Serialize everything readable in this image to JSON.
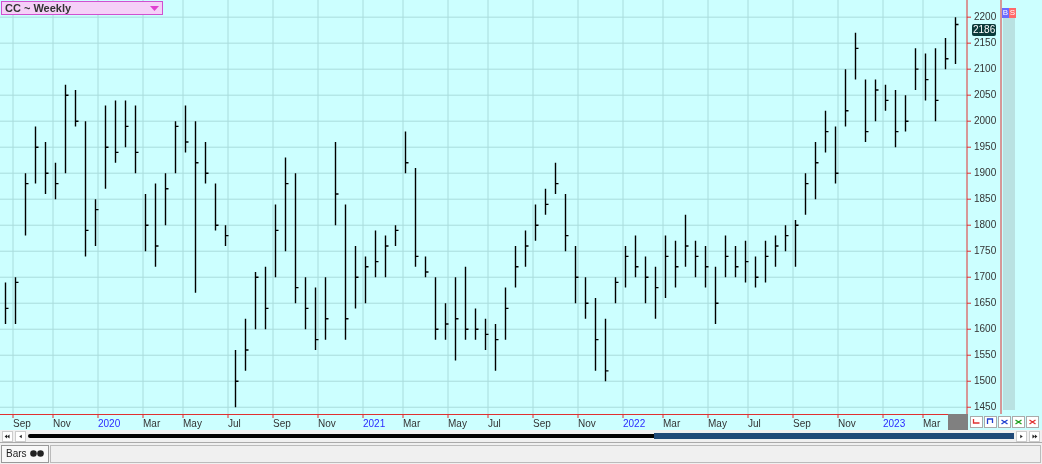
{
  "chart_title": "CC ~ Weekly",
  "last_price": "2186",
  "side_buttons": [
    {
      "label": "B",
      "color": "#6a6aff"
    },
    {
      "label": "S",
      "color": "#ff6a6a"
    }
  ],
  "y_axis_labels": [
    "2200",
    "2150",
    "2100",
    "2050",
    "2000",
    "1950",
    "1900",
    "1850",
    "1800",
    "1750",
    "1700",
    "1650",
    "1600",
    "1550",
    "1500",
    "1450"
  ],
  "x_axis_labels": [
    {
      "label": "Sep",
      "kind": "month"
    },
    {
      "label": "Nov",
      "kind": "month"
    },
    {
      "label": "2020",
      "kind": "year"
    },
    {
      "label": "Mar",
      "kind": "month"
    },
    {
      "label": "May",
      "kind": "month"
    },
    {
      "label": "Jul",
      "kind": "month"
    },
    {
      "label": "Sep",
      "kind": "month"
    },
    {
      "label": "Nov",
      "kind": "month"
    },
    {
      "label": "2021",
      "kind": "year"
    },
    {
      "label": "Mar",
      "kind": "month"
    },
    {
      "label": "May",
      "kind": "month"
    },
    {
      "label": "Jul",
      "kind": "month"
    },
    {
      "label": "Sep",
      "kind": "month"
    },
    {
      "label": "Nov",
      "kind": "month"
    },
    {
      "label": "2022",
      "kind": "year"
    },
    {
      "label": "Mar",
      "kind": "month"
    },
    {
      "label": "May",
      "kind": "month"
    },
    {
      "label": "Jul",
      "kind": "month"
    },
    {
      "label": "Sep",
      "kind": "month"
    },
    {
      "label": "Nov",
      "kind": "month"
    },
    {
      "label": "2023",
      "kind": "year"
    },
    {
      "label": "Mar",
      "kind": "month"
    }
  ],
  "view_tab": {
    "label": "Bars"
  }
}
